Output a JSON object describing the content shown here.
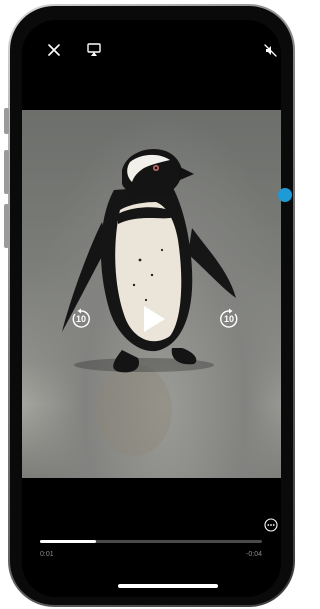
{
  "player": {
    "controls": {
      "close_icon": "close-icon",
      "airplay_icon": "airplay-icon",
      "mute_icon": "speaker-muted-icon",
      "skip_back_seconds": "10",
      "skip_forward_seconds": "10",
      "play_icon": "play-icon",
      "more_icon": "more-options-icon"
    },
    "progress": {
      "elapsed": "0:01",
      "remaining": "-0:04",
      "fraction": 0.25
    }
  },
  "colors": {
    "accent_dot": "#1e9ad6",
    "progress_fill": "#ffffff",
    "progress_track": "#4a4a4a"
  }
}
